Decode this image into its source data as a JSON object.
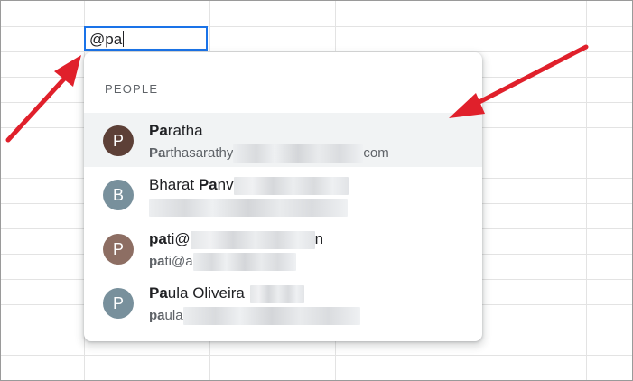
{
  "cell_editor": {
    "value": "@pa"
  },
  "dropdown": {
    "section_header": "PEOPLE",
    "people": [
      {
        "initial": "P",
        "avatar_color": "#5d4037",
        "name_bold": "Pa",
        "name_rest": "ratha",
        "email_bold": "Pa",
        "email_rest": "rthasarathy",
        "email_suffix": "com",
        "selected": true
      },
      {
        "initial": "B",
        "avatar_color": "#78909c",
        "name_prefix": "Bharat ",
        "name_bold": "Pa",
        "name_rest": "nv",
        "selected": false
      },
      {
        "initial": "P",
        "avatar_color": "#8d6e63",
        "name_bold": "pa",
        "name_rest": "ti@",
        "name_suffix": "n",
        "email_bold": "pa",
        "email_rest": "ti@a",
        "selected": false
      },
      {
        "initial": "P",
        "avatar_color": "#78909c",
        "name_bold": "Pa",
        "name_rest": "ula Oliveira",
        "email_bold": "pa",
        "email_rest": "ula",
        "selected": false
      }
    ]
  },
  "colors": {
    "accent": "#1a73e8",
    "arrow": "#e0202b",
    "selected_row": "#f1f3f4"
  }
}
